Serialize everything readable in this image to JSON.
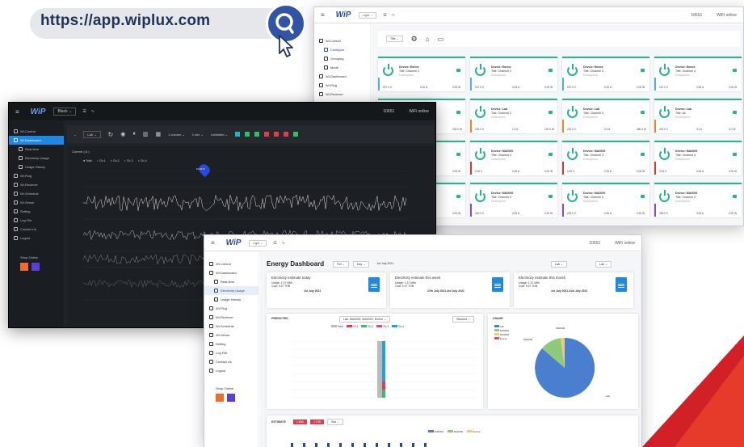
{
  "url": {
    "text": "https://app.wiplux.com"
  },
  "colors": {
    "brand_blue": "#2a4a9a",
    "device_green": "#27b58d",
    "accent_red": "#d32027"
  },
  "win_top": {
    "theme": "Light",
    "user": "10651",
    "status": "WiFi online",
    "sidebar": [
      {
        "label": "Wi-Control",
        "sub": false
      },
      {
        "label": "Configure",
        "sub": true,
        "active": true
      },
      {
        "label": "Grouping",
        "sub": true
      },
      {
        "label": "Mode",
        "sub": true
      },
      {
        "label": "Wi-Dashboard",
        "sub": false
      },
      {
        "label": "Wi-Plug",
        "sub": false
      },
      {
        "label": "Wi-Reciever",
        "sub": false
      }
    ],
    "filter": "Title",
    "devices": [
      {
        "name": "Device: Emme",
        "title": "Title: Channel 1",
        "desc": "Description",
        "v": "247.0 V",
        "a": "0.00 A",
        "w": "0.00 W"
      },
      {
        "name": "Device: Emme",
        "title": "Title: Channel 2",
        "desc": "Description",
        "v": "247.0 V",
        "a": "0.00 A",
        "w": "0.00 W"
      },
      {
        "name": "Device: Emme",
        "title": "Title: Channel 3",
        "desc": "Description",
        "v": "247.0 V",
        "a": "0.00 A",
        "w": "0.00 W"
      },
      {
        "name": "Device: Emme",
        "title": "Title: Channel 4",
        "desc": "Description",
        "v": "247.0 V",
        "a": "0.00 A",
        "w": "0.00 W"
      },
      {
        "name": "Device: Lab",
        "title": "Title: Channel 1",
        "desc": "Description",
        "v": "222.0 V",
        "a": "1.0 A",
        "w": "232.0 W"
      },
      {
        "name": "Device: Lab",
        "title": "Title: Channel 2",
        "desc": "Description",
        "v": "222.0 V",
        "a": "1.0 A",
        "w": "120.0 W"
      },
      {
        "name": "Device: Lab",
        "title": "Title: Channel 3",
        "desc": "Description",
        "v": "222.0 V",
        "a": "2.0 A",
        "w": "280.0 W"
      },
      {
        "name": "Device: Lab",
        "title": "Title: Air",
        "desc": "Description",
        "v": "222.0 V",
        "a": "0.0 A",
        "w": "0.0 W"
      },
      {
        "name": "Device: MA0000",
        "title": "Title: Channel 1",
        "desc": "Description",
        "v": "0.00 V",
        "a": "0.00 A",
        "w": "0.00 W"
      },
      {
        "name": "Device: MA0000",
        "title": "Title: Channel 2",
        "desc": "Description",
        "v": "0.00 V",
        "a": "0.00 A",
        "w": "0.00 W"
      },
      {
        "name": "Device: MA0000",
        "title": "Title: Channel 3",
        "desc": "Description",
        "v": "0.00 V",
        "a": "0.00 A",
        "w": "0.00 W"
      },
      {
        "name": "Device: MA0000",
        "title": "Title: Channel 4",
        "desc": "Description",
        "v": "0.00 V",
        "a": "0.00 A",
        "w": "0.00 W"
      },
      {
        "name": "Device: MA0000",
        "title": "Title: Channel 1",
        "desc": "Description",
        "v": "230.0 V",
        "a": "0.00 A",
        "w": "0.00 W"
      },
      {
        "name": "Device: MA0000",
        "title": "Title: Channel 2",
        "desc": "Description",
        "v": "230.0 V",
        "a": "0.00 A",
        "w": "0.00 W"
      },
      {
        "name": "Device: MA0000",
        "title": "Title: Channel 3",
        "desc": "Description",
        "v": "230.0 V",
        "a": "0.00 A",
        "w": "0.00 W"
      },
      {
        "name": "Device: MA0000",
        "title": "Title: Channel 4",
        "desc": "Description",
        "v": "230.0 V",
        "a": "0.00 A",
        "w": "0.00 W"
      }
    ]
  },
  "win_dark": {
    "theme": "Black",
    "user": "10651",
    "status": "WiFi online",
    "device": "Lab",
    "interval": "1 column",
    "period": "1 sec",
    "limit": "Unlimited",
    "chart_title": "Current ( A )",
    "legend": [
      "Total",
      "Ch-1",
      "Ch-2",
      "Ch-3",
      "Ch-4"
    ],
    "marker": "10:04:47",
    "sidebar": [
      {
        "label": "Wi-Control"
      },
      {
        "label": "Wi-Dashboard",
        "active": true
      },
      {
        "label": "Real-time",
        "sub": true
      },
      {
        "label": "Electricity Usage",
        "sub": true
      },
      {
        "label": "Usage History",
        "sub": true
      },
      {
        "label": "Wi-Plug"
      },
      {
        "label": "Wi-Reciever"
      },
      {
        "label": "Wi-Schedule"
      },
      {
        "label": "Wi-Sense"
      },
      {
        "label": "Setting"
      },
      {
        "label": "Log File"
      },
      {
        "label": "Contact Us"
      },
      {
        "label": "Logout"
      }
    ],
    "shop": "Shop Online"
  },
  "win_energy": {
    "theme": "Light",
    "user": "10651",
    "status": "WiFi online",
    "title": "Energy Dashboard",
    "filters": [
      "Full",
      "Day",
      "1st July 2021"
    ],
    "device_select": "Lab",
    "group_select": "Lab, MA0000, MA0000, Emme",
    "cards": [
      {
        "title": "Electricity estimate today",
        "usage": "Usage: 1.37 kWh",
        "cost": "Cost: 5.37 THB",
        "date": "1st July 2021"
      },
      {
        "title": "Electricity estimate this week",
        "usage": "Usage: 1.37 kWh",
        "cost": "Cost: 5.37 THB",
        "date": "27th July 2021-3rd July 2021"
      },
      {
        "title": "Electricity estimate this month",
        "usage": "Usage: 1.37 kWh",
        "cost": "Cost: 5.37 THB",
        "date": "1st July 2021-31st July 2021"
      }
    ],
    "predicted": "PREDICTED",
    "usage": "USAGE",
    "estimate": "ESTIMATE",
    "pred_legend": [
      "Total",
      "Ch-1",
      "Ch-2",
      "Ch-3",
      "Ch-4"
    ],
    "pie_legend": [
      "Lab",
      "MA0000",
      "MA0000",
      "Emme"
    ],
    "pie_labels": [
      "Lab",
      "MA0000",
      "MA0000"
    ],
    "bar_legend": [
      "MA0000",
      "MA0000",
      "Emme"
    ],
    "sidebar": [
      {
        "label": "Wi-Control"
      },
      {
        "label": "Wi-Dashboard"
      },
      {
        "label": "Real-time",
        "sub": true
      },
      {
        "label": "Electricity Usage",
        "sub": true,
        "active": true
      },
      {
        "label": "Usage History",
        "sub": true
      },
      {
        "label": "Wi-Plug"
      },
      {
        "label": "Wi-Reciever"
      },
      {
        "label": "Wi-Schedule"
      },
      {
        "label": "Wi-Sense"
      },
      {
        "label": "Setting"
      },
      {
        "label": "Log File"
      },
      {
        "label": "Contact Us"
      },
      {
        "label": "Logout"
      }
    ],
    "shop": "Shop Online"
  }
}
